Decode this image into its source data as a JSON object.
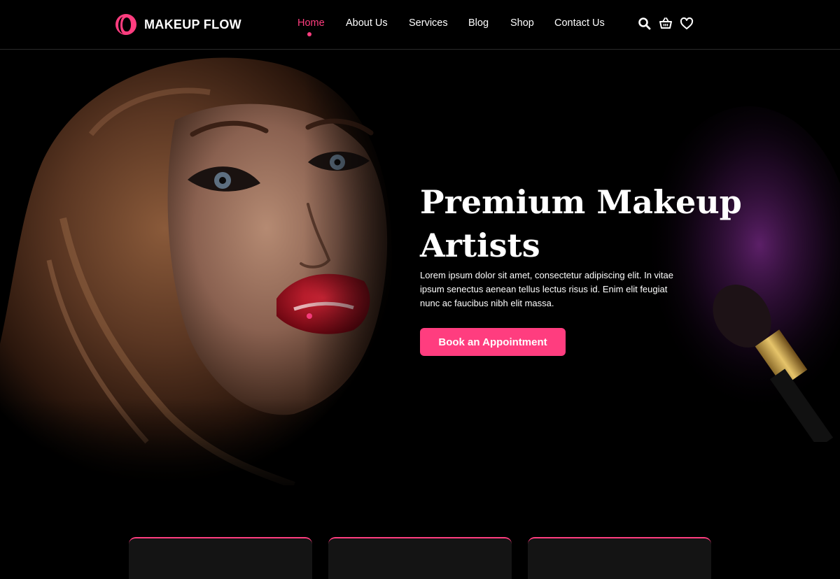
{
  "brand": {
    "name": "MAKEUP FLOW",
    "accent": "#ff3d7f"
  },
  "nav": {
    "items": [
      {
        "label": "Home",
        "active": true
      },
      {
        "label": "About Us",
        "active": false
      },
      {
        "label": "Services",
        "active": false
      },
      {
        "label": "Blog",
        "active": false
      },
      {
        "label": "Shop",
        "active": false
      },
      {
        "label": "Contact Us",
        "active": false
      }
    ],
    "icons": [
      "search-icon",
      "cart-icon",
      "heart-icon"
    ]
  },
  "hero": {
    "title_line1": "Premium Makeup",
    "title_line2": "Artists",
    "text": "Lorem ipsum dolor sit amet, consectetur adipiscing elit. In vitae ipsum senectus aenean tellus lectus risus id. Enim elit feugiat nunc ac faucibus nibh elit massa.",
    "button_label": "Book an Appointment"
  }
}
